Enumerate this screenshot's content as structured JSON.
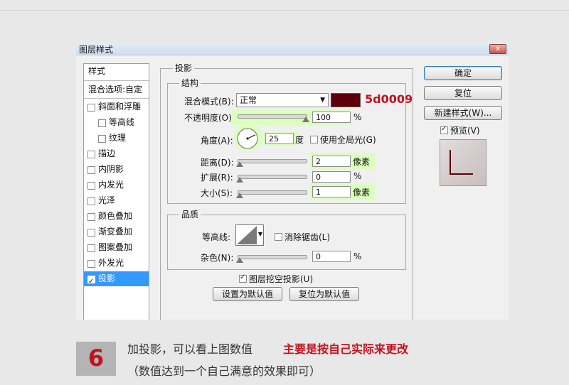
{
  "dialog": {
    "title": "图层样式",
    "close_glyph": "x",
    "sidebar": {
      "header": "样式",
      "blend_label": "混合选项:自定",
      "items": [
        {
          "label": "斜面和浮雕",
          "checked": false
        },
        {
          "label": "等高线",
          "checked": false,
          "indent": true
        },
        {
          "label": "纹理",
          "checked": false,
          "indent": true
        },
        {
          "label": "描边",
          "checked": false
        },
        {
          "label": "内阴影",
          "checked": false
        },
        {
          "label": "内发光",
          "checked": false
        },
        {
          "label": "光泽",
          "checked": false
        },
        {
          "label": "颜色叠加",
          "checked": false
        },
        {
          "label": "渐变叠加",
          "checked": false
        },
        {
          "label": "图案叠加",
          "checked": false
        },
        {
          "label": "外发光",
          "checked": false
        },
        {
          "label": "投影",
          "checked": true,
          "selected": true
        }
      ]
    },
    "shadow": {
      "section_title": "投影",
      "structure_title": "结构",
      "blend_mode_label": "混合模式(B):",
      "blend_mode_value": "正常",
      "color_hex_label": "5d0009",
      "color": "#5d0009",
      "opacity_label": "不透明度(O):",
      "opacity_value": "100",
      "opacity_unit": "%",
      "opacity_fraction": 1.0,
      "angle_label": "角度(A):",
      "angle_value": "25",
      "angle_unit": "度",
      "global_light_label": "使用全局光(G)",
      "distance_label": "距离(D):",
      "distance_value": "2",
      "distance_unit": "像素",
      "spread_label": "扩展(R):",
      "spread_value": "0",
      "spread_unit": "%",
      "size_label": "大小(S):",
      "size_value": "1",
      "size_unit": "像素",
      "quality_title": "品质",
      "contour_label": "等高线:",
      "antialias_label": "消除锯齿(L)",
      "noise_label": "杂色(N):",
      "noise_value": "0",
      "noise_unit": "%",
      "knockout_label": "图层挖空投影(U)",
      "make_default_label": "设置为默认值",
      "reset_default_label": "复位为默认值"
    },
    "buttons": {
      "ok": "确定",
      "reset": "复位",
      "new_style": "新建样式(W)...",
      "preview": "预览(V)"
    }
  },
  "caption": {
    "step_number": "6",
    "line1": "加投影，可以看上图数值",
    "emphasis": "主要是按自己实际来更改",
    "line2": "（数值达到一个自己满意的效果即可）",
    "accent_color": "#c1121f"
  }
}
